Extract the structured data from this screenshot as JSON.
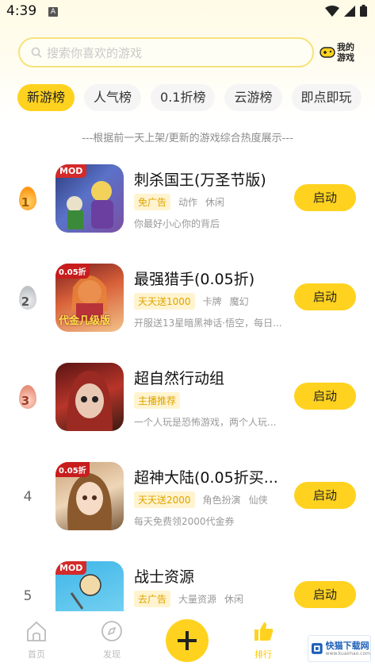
{
  "status_bar": {
    "time": "4:39",
    "notif_icon": "A"
  },
  "search": {
    "placeholder": "搜索你喜欢的游戏"
  },
  "my_games": {
    "line1": "我的",
    "line2": "游戏"
  },
  "tabs": [
    {
      "label": "新游榜",
      "active": true
    },
    {
      "label": "人气榜",
      "active": false
    },
    {
      "label": "0.1折榜",
      "active": false
    },
    {
      "label": "云游榜",
      "active": false
    },
    {
      "label": "即点即玩",
      "active": false
    }
  ],
  "subtitle": "---根据前一天上架/更新的游戏综合热度展示---",
  "games": [
    {
      "rank": "1",
      "title": "刺杀国王(万圣节版)",
      "badge": "MOD",
      "tags": [
        "免广告",
        "动作",
        "休闲"
      ],
      "desc": "你最好小心你的背后",
      "button": "启动"
    },
    {
      "rank": "2",
      "title": "最强猎手(0.05折)",
      "badge": "0.05折",
      "tags": [
        "天天送1000",
        "卡牌",
        "魔幻"
      ],
      "desc": "开服送13星暗黑神话·悟空，每日...",
      "button": "启动",
      "icon_caption": "代金几级版"
    },
    {
      "rank": "3",
      "title": "超自然行动组",
      "badge": "",
      "tags": [
        "主播推荐"
      ],
      "desc": "一个人玩是恐怖游戏，两个人玩...",
      "button": "启动"
    },
    {
      "rank": "4",
      "title": "超神大陆(0.05折买...",
      "badge": "0.05折",
      "tags": [
        "天天送2000",
        "角色扮演",
        "仙侠"
      ],
      "desc": "每天免费领2000代金券",
      "button": "启动"
    },
    {
      "rank": "5",
      "title": "战士资源",
      "badge": "MOD",
      "tags": [
        "去广告",
        "大量资源",
        "休闲"
      ],
      "desc": "",
      "button": "启动"
    }
  ],
  "nav": [
    {
      "label": "首页"
    },
    {
      "label": "发现"
    },
    {
      "label": ""
    },
    {
      "label": "排行"
    }
  ],
  "watermark": {
    "title_line1": "快猫",
    "title_line2": "下载网",
    "url": "www.kuaimao.com"
  }
}
